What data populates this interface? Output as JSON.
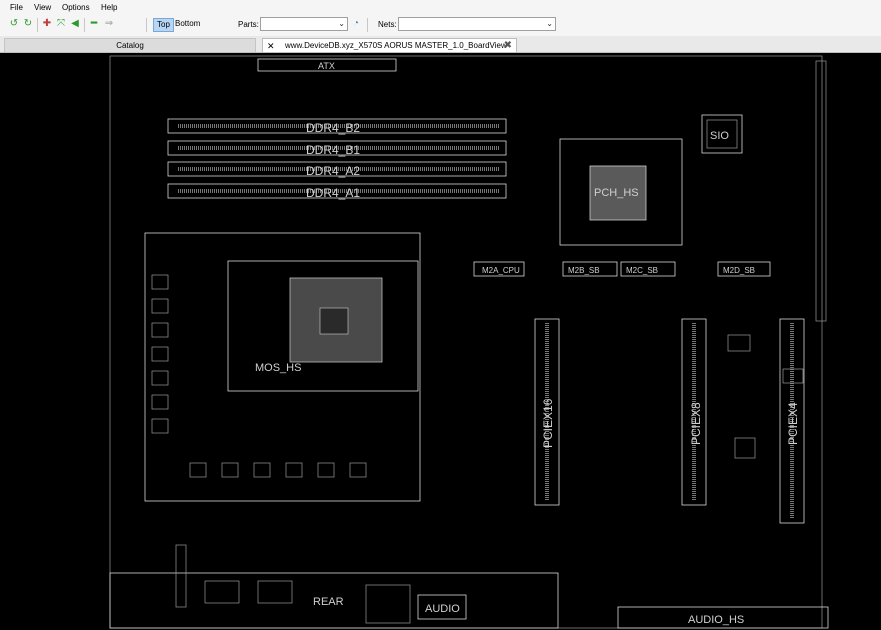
{
  "menu": {
    "file": "File",
    "view": "View",
    "options": "Options",
    "help": "Help"
  },
  "toolbar": {
    "top_label": "Top",
    "bottom_label": "Bottom",
    "parts_label": "Parts:",
    "parts_value": "",
    "nets_label": "Nets:",
    "nets_value": ""
  },
  "tabs": {
    "catalog": "Catalog",
    "board": "www.DeviceDB.xyz_X570S AORUS MASTER_1.0_BoardView"
  },
  "board": {
    "atx": "ATX",
    "ddr4_b2": "DDR4_B2",
    "ddr4_b1": "DDR4_B1",
    "ddr4_a2": "DDR4_A2",
    "ddr4_a1": "DDR4_A1",
    "sio": "SIO",
    "pch_hs": "PCH_HS",
    "m2a_cpu": "M2A_CPU",
    "m2b_sb": "M2B_SB",
    "m2c_sb": "M2C_SB",
    "m2d_sb": "M2D_SB",
    "mos_hs": "MOS_HS",
    "pciex16": "PCIEX16",
    "pciex8": "PCIEX8",
    "pciex4": "PCIEX4",
    "rear": "REAR",
    "audio": "AUDIO",
    "audio_hs": "AUDIO_HS"
  }
}
